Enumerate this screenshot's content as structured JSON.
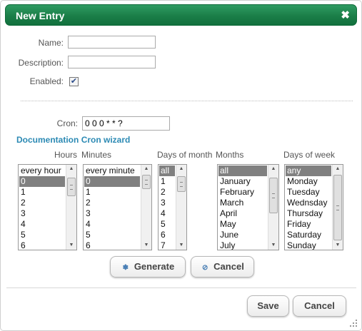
{
  "dialog": {
    "title": "New Entry",
    "close_icon": "close-icon"
  },
  "form": {
    "name_label": "Name:",
    "name_value": "",
    "description_label": "Description:",
    "description_value": "",
    "enabled_label": "Enabled:",
    "enabled_checked": true,
    "cron_label": "Cron:",
    "cron_value": "0 0 0 * * ?"
  },
  "links": {
    "documentation": "Documentation",
    "cron_wizard": "Cron wizard"
  },
  "columns": {
    "hours": "Hours",
    "minutes": "Minutes",
    "days_of_month": "Days of month",
    "months": "Months",
    "days_of_week": "Days of week"
  },
  "lists": {
    "hours": {
      "items": [
        "every hour",
        "0",
        "1",
        "2",
        "3",
        "4",
        "5",
        "6"
      ],
      "selected": "0"
    },
    "minutes": {
      "items": [
        "every minute",
        "0",
        "1",
        "2",
        "3",
        "4",
        "5",
        "6"
      ],
      "selected": "0"
    },
    "days_of_month": {
      "items": [
        "all",
        "1",
        "2",
        "3",
        "4",
        "5",
        "6",
        "7"
      ],
      "selected": "all"
    },
    "months": {
      "items": [
        "all",
        "January",
        "February",
        "March",
        "April",
        "May",
        "June",
        "July"
      ],
      "selected": "all"
    },
    "days_of_week": {
      "items": [
        "any",
        "Monday",
        "Tuesday",
        "Wednsday",
        "Thursday",
        "Friday",
        "Saturday",
        "Sunday"
      ],
      "selected": "any"
    }
  },
  "buttons": {
    "generate": "Generate",
    "cancel_wizard": "Cancel",
    "save": "Save",
    "cancel": "Cancel"
  }
}
